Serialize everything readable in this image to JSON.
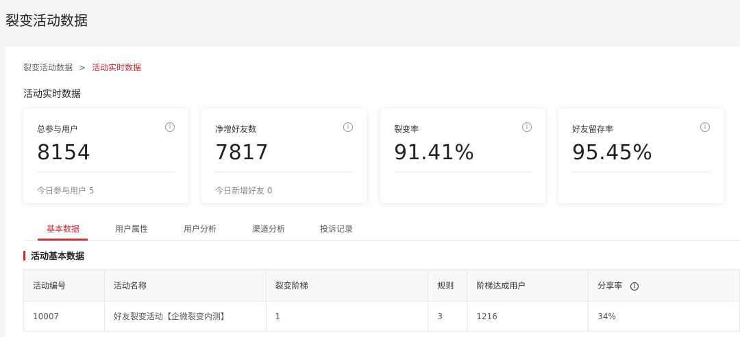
{
  "page": {
    "title": "裂变活动数据"
  },
  "breadcrumb": {
    "parent": "裂变活动数据",
    "separator": ">",
    "current": "活动实时数据"
  },
  "section_title": "活动实时数据",
  "info_glyph": "i",
  "cards": [
    {
      "label": "总参与用户",
      "value": "8154",
      "sub": "今日参与用户 5"
    },
    {
      "label": "净增好友数",
      "value": "7817",
      "sub": "今日新增好友 0"
    },
    {
      "label": "裂变率",
      "value": "91.41%",
      "sub": ""
    },
    {
      "label": "好友留存率",
      "value": "95.45%",
      "sub": ""
    }
  ],
  "tabs": [
    {
      "label": "基本数据",
      "active": true
    },
    {
      "label": "用户属性",
      "active": false
    },
    {
      "label": "用户分析",
      "active": false
    },
    {
      "label": "渠道分析",
      "active": false
    },
    {
      "label": "投诉记录",
      "active": false
    }
  ],
  "table_section_title": "活动基本数据",
  "table": {
    "headers": [
      "活动编号",
      "活动名称",
      "裂变阶梯",
      "规则",
      "阶梯达成用户",
      "分享率"
    ],
    "rows": [
      [
        "10007",
        "好友裂变活动【企微裂变内测】",
        "1",
        "3",
        "1216",
        "34%"
      ]
    ]
  },
  "colors": {
    "accent": "#e0242b",
    "background": "#f3f4f6",
    "card": "#ffffff"
  }
}
